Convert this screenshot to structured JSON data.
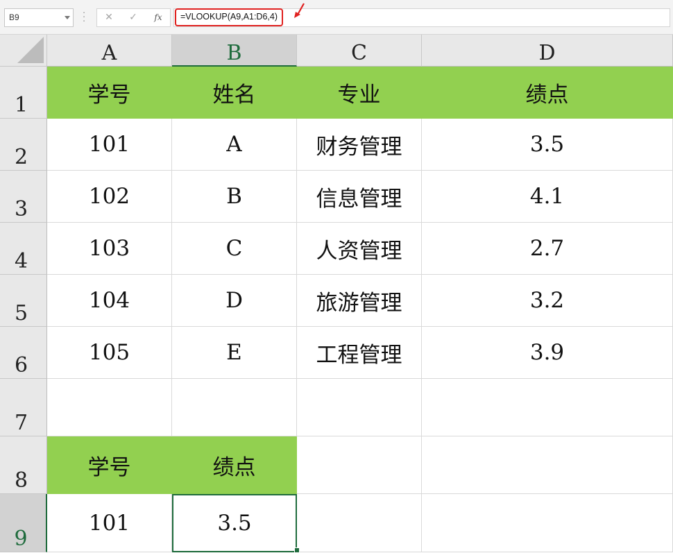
{
  "formula_bar": {
    "name_box": "B9",
    "cancel_symbol": "✕",
    "enter_symbol": "✓",
    "fx_label": "fx",
    "formula": "=VLOOKUP(A9,A1:D6,4)"
  },
  "columns": [
    "A",
    "B",
    "C",
    "D"
  ],
  "rows": [
    "1",
    "2",
    "3",
    "4",
    "5",
    "6",
    "7",
    "8",
    "9"
  ],
  "selected_cell": "B9",
  "colors": {
    "header_fill": "#92d050",
    "selection": "#1e6b3c",
    "annotation": "#e0211f"
  },
  "cells": {
    "A1": "学号",
    "B1": "姓名",
    "C1": "专业",
    "D1": "绩点",
    "A2": "101",
    "B2": "A",
    "C2": "财务管理",
    "D2": "3.5",
    "A3": "102",
    "B3": "B",
    "C3": "信息管理",
    "D3": "4.1",
    "A4": "103",
    "B4": "C",
    "C4": "人资管理",
    "D4": "2.7",
    "A5": "104",
    "B5": "D",
    "C5": "旅游管理",
    "D5": "3.2",
    "A6": "105",
    "B6": "E",
    "C6": "工程管理",
    "D6": "3.9",
    "A8": "学号",
    "B8": "绩点",
    "A9": "101",
    "B9": "3.5"
  }
}
